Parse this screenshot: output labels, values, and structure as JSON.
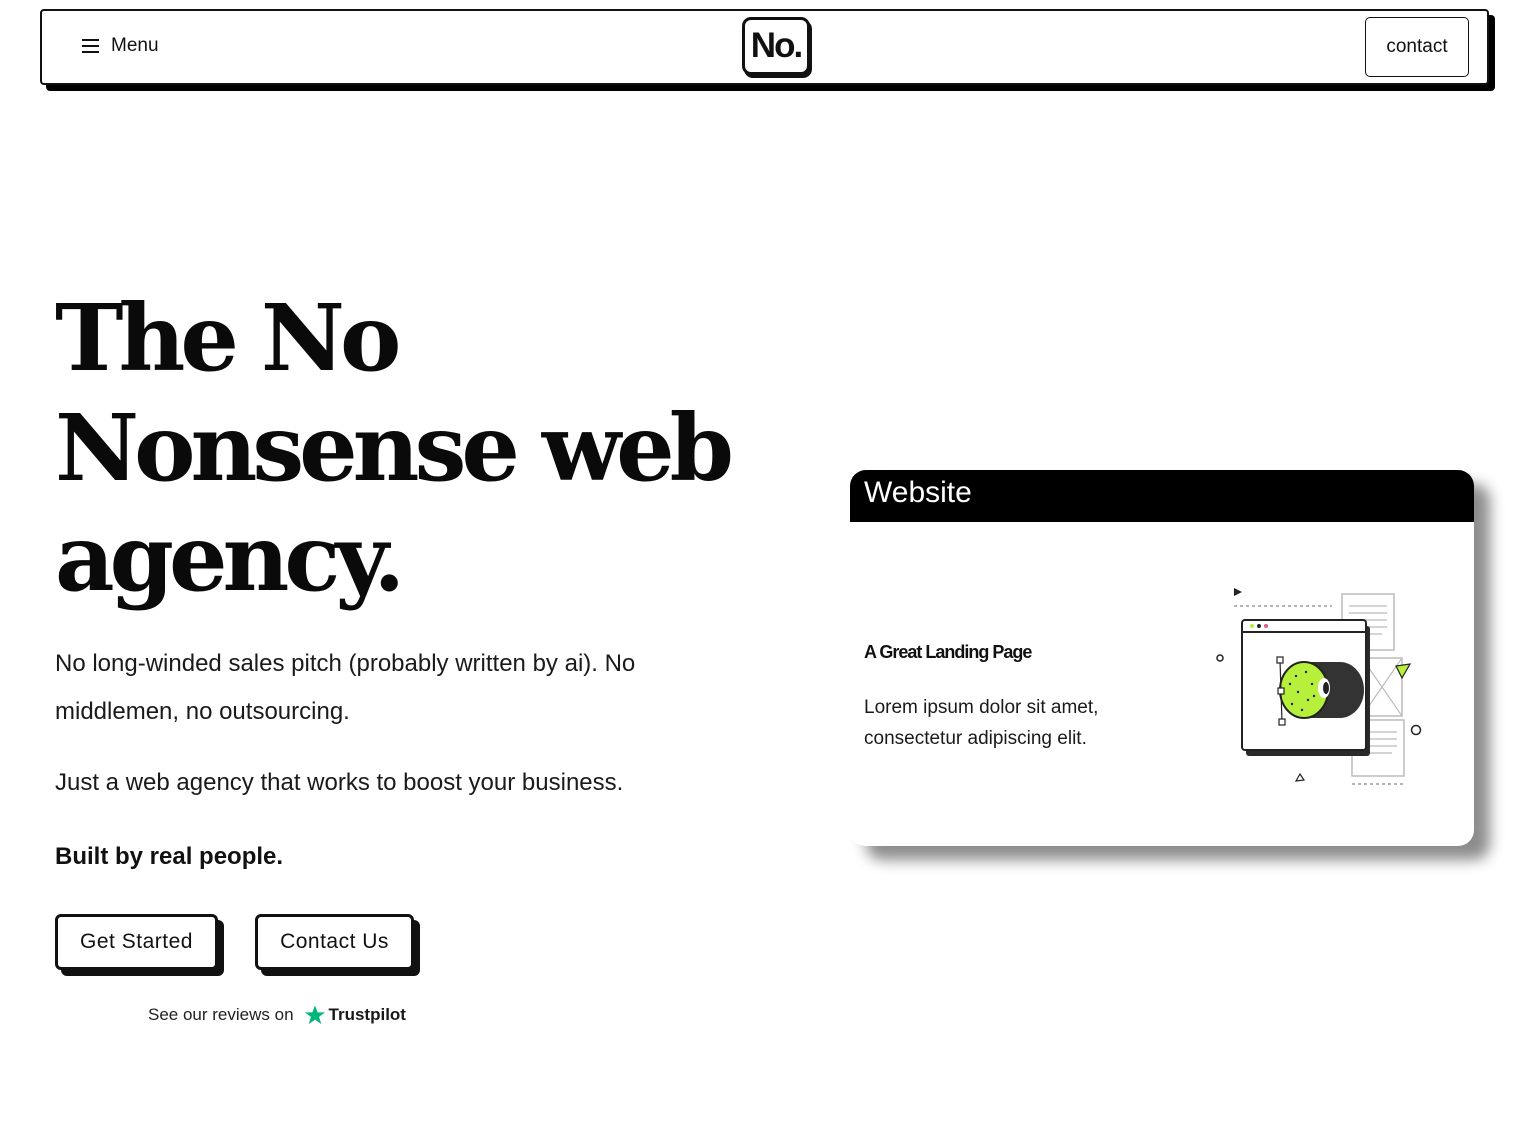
{
  "header": {
    "menu_label": "Menu",
    "logo_text": "No.",
    "contact_label": "contact"
  },
  "hero": {
    "title_line1": "The No",
    "title_line2": "Nonsense web",
    "title_line3": "agency.",
    "paragraph1": "No long-winded sales pitch (probably written by ai). No middlemen, no outsourcing.",
    "paragraph2": "Just a web agency that works to boost your business.",
    "paragraph3": "Built by real people.",
    "cta_primary": "Get Started",
    "cta_secondary": "Contact Us",
    "reviews_text": "See our reviews on",
    "reviews_brand": "Trustpilot"
  },
  "card": {
    "title": "Website",
    "subtitle": "A Great Landing Page",
    "body": "Lorem ipsum dolor sit amet, consectetur adipiscing elit."
  },
  "colors": {
    "accent_green": "#b7f03a",
    "trustpilot_green": "#00b67a",
    "ink": "#111111"
  },
  "icons": {
    "menu": "hamburger-icon",
    "reviews": "trustpilot-star-icon",
    "illustration": "landing-page-illustration"
  }
}
